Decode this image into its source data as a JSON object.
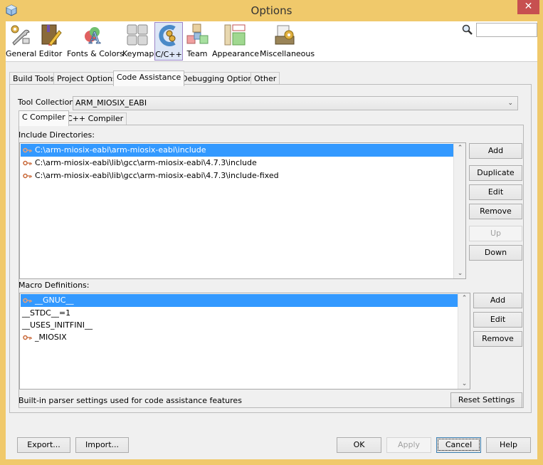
{
  "window": {
    "title": "Options",
    "close_label": "✕"
  },
  "categories": [
    {
      "label": "General",
      "icon": "wrench-gear-icon",
      "selected": false
    },
    {
      "label": "Editor",
      "icon": "book-pencil-icon",
      "selected": false
    },
    {
      "label": "Fonts & Colors",
      "icon": "font-colors-icon",
      "selected": false
    },
    {
      "label": "Keymap",
      "icon": "keyboard-icon",
      "selected": false
    },
    {
      "label": "C/C++",
      "icon": "cpp-icon",
      "selected": true
    },
    {
      "label": "Team",
      "icon": "team-blocks-icon",
      "selected": false
    },
    {
      "label": "Appearance",
      "icon": "appearance-icon",
      "selected": false
    },
    {
      "label": "Miscellaneous",
      "icon": "misc-folder-gear-icon",
      "selected": false
    }
  ],
  "search": {
    "value": "",
    "placeholder": ""
  },
  "tabs": [
    {
      "label": "Build Tools",
      "active": false
    },
    {
      "label": "Project Options",
      "active": false
    },
    {
      "label": "Code Assistance",
      "active": true
    },
    {
      "label": "Debugging Options",
      "active": false
    },
    {
      "label": "Other",
      "active": false
    }
  ],
  "tool_collection": {
    "label": "Tool Collection:",
    "value": "ARM_MIOSIX_EABI"
  },
  "compiler_tabs": [
    {
      "label": "C Compiler",
      "active": true
    },
    {
      "label": "C++ Compiler",
      "active": false
    }
  ],
  "include_dirs": {
    "label": "Include Directories:",
    "items": [
      {
        "text": "C:\\arm-miosix-eabi\\arm-miosix-eabi\\include",
        "builtin": true,
        "selected": true
      },
      {
        "text": "C:\\arm-miosix-eabi\\lib\\gcc\\arm-miosix-eabi\\4.7.3\\include",
        "builtin": true,
        "selected": false
      },
      {
        "text": "C:\\arm-miosix-eabi\\lib\\gcc\\arm-miosix-eabi\\4.7.3\\include-fixed",
        "builtin": true,
        "selected": false
      }
    ],
    "buttons": {
      "add": "Add",
      "duplicate": "Duplicate",
      "edit": "Edit",
      "remove": "Remove",
      "up": "Up",
      "down": "Down"
    }
  },
  "macros": {
    "label": "Macro Definitions:",
    "items": [
      {
        "text": "__GNUC__",
        "builtin": true,
        "selected": true
      },
      {
        "text": "__STDC__=1",
        "builtin": false,
        "selected": false
      },
      {
        "text": "__USES_INITFINI__",
        "builtin": false,
        "selected": false
      },
      {
        "text": "_MIOSIX",
        "builtin": true,
        "selected": false
      }
    ],
    "buttons": {
      "add": "Add",
      "edit": "Edit",
      "remove": "Remove"
    }
  },
  "footer_note": "Built-in parser settings used for code assistance features",
  "reset_settings": "Reset Settings",
  "dialog_buttons": {
    "export": "Export...",
    "import": "Import...",
    "ok": "OK",
    "apply": "Apply",
    "cancel": "Cancel",
    "help": "Help"
  },
  "colors": {
    "title_bar": "#f0c96b",
    "close_button": "#c75050",
    "selection": "#3399ff",
    "selected_category_border": "#9c84c6"
  }
}
